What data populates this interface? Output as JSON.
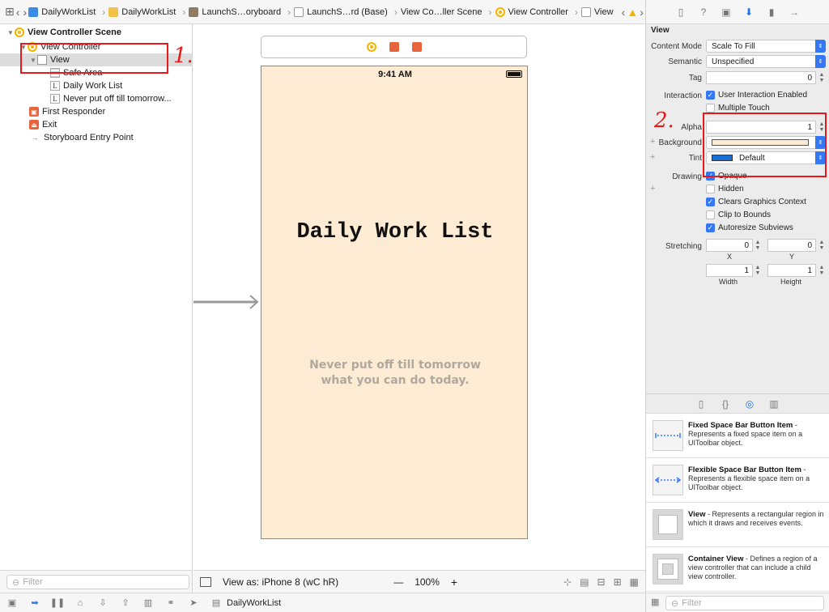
{
  "jumpbar": {
    "crumbs": [
      "DailyWorkList",
      "DailyWorkList",
      "LaunchS…oryboard",
      "LaunchS…rd (Base)",
      "View Co…ller Scene",
      "View Controller",
      "View"
    ]
  },
  "outline": {
    "scene": "View Controller Scene",
    "view_controller": "View Controller",
    "view": "View",
    "safe_area": "Safe Area",
    "label1": "Daily Work List",
    "label2": "Never put off till tomorrow...",
    "first_responder": "First Responder",
    "exit": "Exit",
    "entry_point": "Storyboard Entry Point",
    "filter_placeholder": "Filter",
    "annotation": "1."
  },
  "canvas": {
    "status_time": "9:41 AM",
    "title": "Daily Work List",
    "quote_line1": "Never put off till tomorrow",
    "quote_line2": "what you can do today.",
    "view_as": "View as: iPhone 8 (wC hR)",
    "zoom_minus": "—",
    "zoom": "100%",
    "zoom_plus": "+",
    "background_color": "#fdebd3"
  },
  "inspector": {
    "section": "View",
    "content_mode_label": "Content Mode",
    "content_mode_value": "Scale To Fill",
    "semantic_label": "Semantic",
    "semantic_value": "Unspecified",
    "tag_label": "Tag",
    "tag_value": "0",
    "interaction_label": "Interaction",
    "user_interaction": "User Interaction Enabled",
    "multiple_touch": "Multiple Touch",
    "alpha_label": "Alpha",
    "alpha_value": "1",
    "background_label": "Background",
    "tint_label": "Tint",
    "tint_value": "Default",
    "drawing_label": "Drawing",
    "opaque": "Opaque",
    "hidden": "Hidden",
    "clears_graphics": "Clears Graphics Context",
    "clip_to_bounds": "Clip to Bounds",
    "autoresize": "Autoresize Subviews",
    "stretching_label": "Stretching",
    "stretch_x": "0",
    "stretch_y": "0",
    "stretch_width": "1",
    "stretch_height": "1",
    "x_label": "X",
    "y_label": "Y",
    "width_label": "Width",
    "height_label": "Height",
    "annotation": "2.",
    "tint_color": "#1a6fd6"
  },
  "library": {
    "items": [
      {
        "title": "Fixed Space Bar Button Item",
        "desc": " - Represents a fixed space item on a UIToolbar object."
      },
      {
        "title": "Flexible Space Bar Button Item",
        "desc": " - Represents a flexible space item on a UIToolbar object."
      },
      {
        "title": "View",
        "desc": " - Represents a rectangular region in which it draws and receives events."
      },
      {
        "title": "Container View",
        "desc": " - Defines a region of a view controller that can include a child view controller."
      }
    ],
    "filter_placeholder": "Filter"
  },
  "bottombar": {
    "target": "DailyWorkList"
  }
}
